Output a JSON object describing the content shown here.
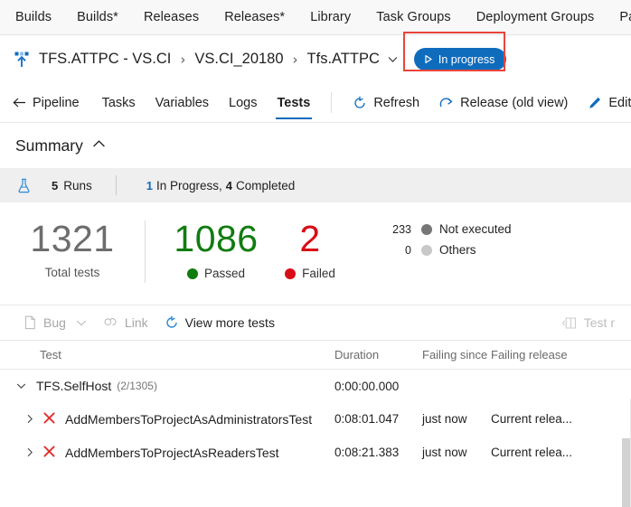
{
  "hub_nav": {
    "items": [
      {
        "label": "Builds",
        "name": "hubnav-builds"
      },
      {
        "label": "Builds*",
        "name": "hubnav-builds-star"
      },
      {
        "label": "Releases",
        "name": "hubnav-releases"
      },
      {
        "label": "Releases*",
        "name": "hubnav-releases-star"
      },
      {
        "label": "Library",
        "name": "hubnav-library"
      },
      {
        "label": "Task Groups",
        "name": "hubnav-task-groups"
      },
      {
        "label": "Deployment Groups",
        "name": "hubnav-deployment-groups"
      },
      {
        "label": "Packages",
        "name": "hubnav-packages"
      }
    ]
  },
  "breadcrumb": {
    "icon": "release-pipeline-icon",
    "title": "TFS.ATTPC - VS.CI",
    "separator": "›",
    "release": "VS.CI_20180",
    "stage": "Tfs.ATTPC",
    "stage_caret": "chevron-down-icon",
    "status": {
      "label": "In progress",
      "icon": "play-icon",
      "color": "#0f6cbd"
    },
    "annotation_color": "#e8453c"
  },
  "pivots": {
    "items": [
      {
        "label": "Pipeline",
        "icon": "arrow-left-icon",
        "selected": false,
        "name": "tab-pipeline"
      },
      {
        "label": "Tasks",
        "icon": "",
        "selected": false,
        "name": "tab-tasks"
      },
      {
        "label": "Variables",
        "icon": "",
        "selected": false,
        "name": "tab-variables"
      },
      {
        "label": "Logs",
        "icon": "",
        "selected": false,
        "name": "tab-logs"
      },
      {
        "label": "Tests",
        "icon": "",
        "selected": true,
        "name": "tab-tests"
      }
    ],
    "commands": [
      {
        "label": "Refresh",
        "icon": "refresh-icon",
        "name": "refresh-button"
      },
      {
        "label": "Release (old view)",
        "icon": "external-link-icon",
        "name": "release-old-view-button"
      },
      {
        "label": "Edit re",
        "icon": "pencil-icon",
        "name": "edit-release-button"
      }
    ]
  },
  "summary": {
    "title": "Summary",
    "collapse_icon": "chevron-up-icon",
    "runs": {
      "icon": "flask-icon",
      "count": "5",
      "label": "Runs",
      "in_progress_count": "1",
      "in_progress_label": "In Progress,",
      "completed_count": "4",
      "completed_label": "Completed"
    },
    "metrics": {
      "total": {
        "value": "1321",
        "label": "Total tests"
      },
      "passed": {
        "value": "1086",
        "label": "Passed",
        "color": "#107c10"
      },
      "failed": {
        "value": "2",
        "label": "Failed",
        "color": "#d90d16"
      },
      "not_executed": {
        "value": "233",
        "label": "Not executed",
        "color": "#767676"
      },
      "others": {
        "value": "0",
        "label": "Others",
        "color": "#c8c8c8"
      }
    }
  },
  "results_toolbar": {
    "bug": {
      "label": "Bug",
      "icon": "bug-file-icon",
      "caret": "chevron-down-icon"
    },
    "link": {
      "label": "Link",
      "icon": "link-icon"
    },
    "view_more": {
      "label": "View more tests",
      "icon": "refresh-circle-icon"
    },
    "test_panel": {
      "label": "Test r",
      "icon": "panel-right-icon"
    }
  },
  "table": {
    "columns": [
      {
        "label": "Test",
        "name": "column-header-test"
      },
      {
        "label": "Duration",
        "name": "column-header-duration"
      },
      {
        "label": "Failing since",
        "name": "column-header-failing-since"
      },
      {
        "label": "Failing release",
        "name": "column-header-failing-release"
      }
    ],
    "rows": [
      {
        "type": "group",
        "chevron": "chevron-down-icon",
        "name": "TFS.SelfHost",
        "count": "(2/1305)",
        "duration": "0:00:00.000",
        "failing_since": "",
        "failing_release": ""
      },
      {
        "type": "test",
        "chevron": "chevron-right-icon",
        "status_icon": "failed-x-icon",
        "name": "AddMembersToProjectAsAdministratorsTest",
        "duration": "0:08:01.047",
        "failing_since": "just now",
        "failing_release": "Current relea..."
      },
      {
        "type": "test",
        "chevron": "chevron-right-icon",
        "status_icon": "failed-x-icon",
        "name": "AddMembersToProjectAsReadersTest",
        "duration": "0:08:21.383",
        "failing_since": "just now",
        "failing_release": "Current relea..."
      }
    ]
  }
}
